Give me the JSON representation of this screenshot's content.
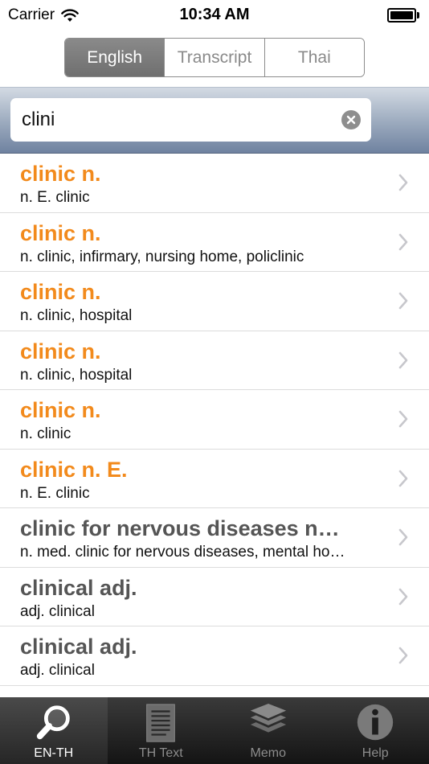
{
  "status_bar": {
    "carrier": "Carrier",
    "time": "10:34 AM"
  },
  "segmented": {
    "options": [
      "English",
      "Transcript",
      "Thai"
    ],
    "selected": "English"
  },
  "search": {
    "value": "clini"
  },
  "results": [
    {
      "title": "clinic n.",
      "subtitle": "n. E. clinic",
      "highlight": true
    },
    {
      "title": "clinic n.",
      "subtitle": "n. clinic, infirmary, nursing home, policlinic",
      "highlight": true
    },
    {
      "title": "clinic n.",
      "subtitle": "n. clinic, hospital",
      "highlight": true
    },
    {
      "title": "clinic n.",
      "subtitle": "n. clinic, hospital",
      "highlight": true
    },
    {
      "title": "clinic n.",
      "subtitle": "n. clinic",
      "highlight": true
    },
    {
      "title": "clinic n. E.",
      "subtitle": "n. E. clinic",
      "highlight": true
    },
    {
      "title": "clinic for nervous diseases n…",
      "subtitle": "n. med. clinic for nervous diseases, mental ho…",
      "highlight": false
    },
    {
      "title": "clinical adj.",
      "subtitle": "adj. clinical",
      "highlight": false
    },
    {
      "title": "clinical adj.",
      "subtitle": "adj. clinical",
      "highlight": false
    }
  ],
  "tabbar": {
    "tabs": [
      {
        "label": "EN-TH",
        "icon": "magnifier-icon",
        "active": true
      },
      {
        "label": "TH Text",
        "icon": "document-icon",
        "active": false
      },
      {
        "label": "Memo",
        "icon": "layers-icon",
        "active": false
      },
      {
        "label": "Help",
        "icon": "info-icon",
        "active": false
      }
    ]
  },
  "colors": {
    "highlight_title": "#f28a1c",
    "normal_title": "#555555"
  }
}
